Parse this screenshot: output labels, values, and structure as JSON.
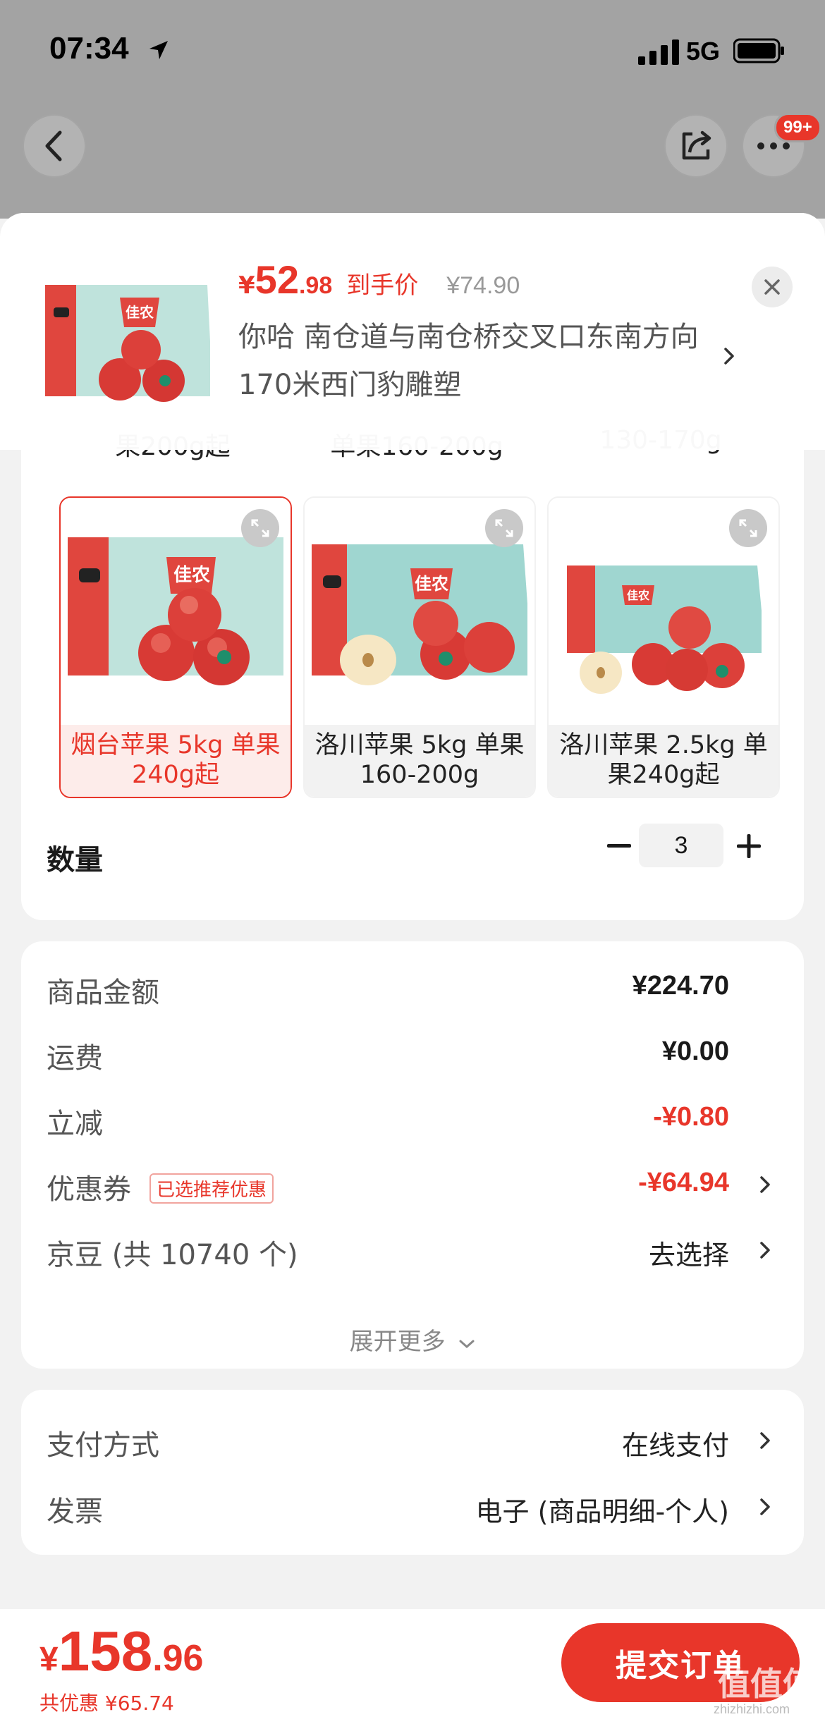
{
  "status_bar": {
    "time": "07:34",
    "network": "5G"
  },
  "nav": {
    "badge": "99+"
  },
  "header": {
    "price_yen": "¥",
    "price_int": "52",
    "price_dec": ".98",
    "price_tag": "到手价",
    "original_price": "¥74.90",
    "address": "你哈  南仓道与南仓桥交叉口东南方向170米西门豹雕塑"
  },
  "specs": {
    "partial_row": [
      "果200g起",
      "单果160-200g",
      "130-170g"
    ],
    "items": [
      {
        "label": "烟台苹果 5kg 单果240g起",
        "selected": true
      },
      {
        "label": "洛川苹果 5kg 单果160-200g",
        "selected": false
      },
      {
        "label": "洛川苹果 2.5kg 单果240g起",
        "selected": false
      }
    ],
    "box_brand": "佳农"
  },
  "quantity": {
    "label": "数量",
    "value": "3"
  },
  "price_detail": {
    "rows": [
      {
        "label": "商品金额",
        "value": "¥224.70"
      },
      {
        "label": "运费",
        "value": "¥0.00"
      },
      {
        "label": "立减",
        "value": "-¥0.80"
      },
      {
        "label": "优惠券",
        "tag": "已选推荐优惠",
        "value": "-¥64.94"
      },
      {
        "label": "京豆 (共 10740 个)",
        "value": "去选择"
      }
    ],
    "expand_more": "展开更多"
  },
  "payment": {
    "rows": [
      {
        "label": "支付方式",
        "value": "在线支付"
      },
      {
        "label": "发票",
        "value": "电子 (商品明细-个人)"
      }
    ]
  },
  "bottom": {
    "total_yen": "¥",
    "total_int": "158",
    "total_dec": ".96",
    "savings": "共优惠 ¥65.74",
    "submit_label": "提交订单"
  },
  "watermark": {
    "main": "值值值",
    "sub": "zhizhizhi.com"
  },
  "colors": {
    "accent": "#e8362a",
    "box_teal": "#bfe3dc",
    "box_red": "#e0463e"
  }
}
